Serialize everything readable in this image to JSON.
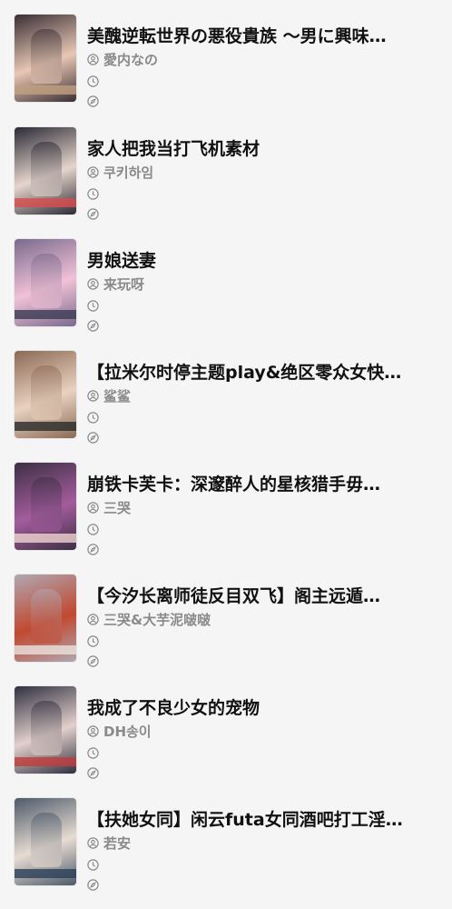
{
  "items": [
    {
      "title": "美醜逆転世界の悪役貴族 ～男に興味…",
      "author": "愛内なの",
      "icons": {
        "author": "user-circle-icon",
        "time": "clock-icon",
        "source": "compass-icon"
      },
      "cover_colors": [
        "#3a2f35",
        "#e8c7b4",
        "#c0a080"
      ]
    },
    {
      "title": "家人把我当打飞机素材",
      "author": "쿠키하임",
      "icons": {
        "author": "user-circle-icon",
        "time": "clock-icon",
        "source": "compass-icon"
      },
      "cover_colors": [
        "#2a2a35",
        "#e6d5cc",
        "#d94c4c"
      ]
    },
    {
      "title": "男娘送妻",
      "author": "来玩呀",
      "icons": {
        "author": "user-circle-icon",
        "time": "clock-icon",
        "source": "compass-icon"
      },
      "cover_colors": [
        "#7a6a8e",
        "#f1c1d6",
        "#3b3b55"
      ]
    },
    {
      "title": "【拉米尔时停主题play&绝区零众女快…",
      "author": "鲨鲨",
      "icons": {
        "author": "user-circle-icon",
        "time": "clock-icon",
        "source": "compass-icon"
      },
      "cover_colors": [
        "#8a6a55",
        "#e9d2c0",
        "#2a2a2a"
      ]
    },
    {
      "title": "崩铁卡芙卡：深邃醉人的星核猎手毋…",
      "author": "三哭",
      "icons": {
        "author": "user-circle-icon",
        "time": "clock-icon",
        "source": "compass-icon"
      },
      "cover_colors": [
        "#3d2f45",
        "#a35c9c",
        "#efd5d0"
      ]
    },
    {
      "title": "【今汐长离师徒反目双飞】阁主远遁…",
      "author": "三哭&大芋泥啵啵",
      "icons": {
        "author": "user-circle-icon",
        "time": "clock-icon",
        "source": "compass-icon"
      },
      "cover_colors": [
        "#b0a7b3",
        "#c1492f",
        "#ece2dc"
      ]
    },
    {
      "title": "我成了不良少女的宠物",
      "author": "DH송이",
      "icons": {
        "author": "user-circle-icon",
        "time": "clock-icon",
        "source": "compass-icon"
      },
      "cover_colors": [
        "#2f3040",
        "#e3d0cc",
        "#c23b3b"
      ]
    },
    {
      "title": "【扶她女同】闲云futa女同酒吧打工淫…",
      "author": "若安",
      "icons": {
        "author": "user-circle-icon",
        "time": "clock-icon",
        "source": "compass-icon"
      },
      "cover_colors": [
        "#4c5a6a",
        "#e8dcd2",
        "#2c3e57"
      ]
    }
  ]
}
